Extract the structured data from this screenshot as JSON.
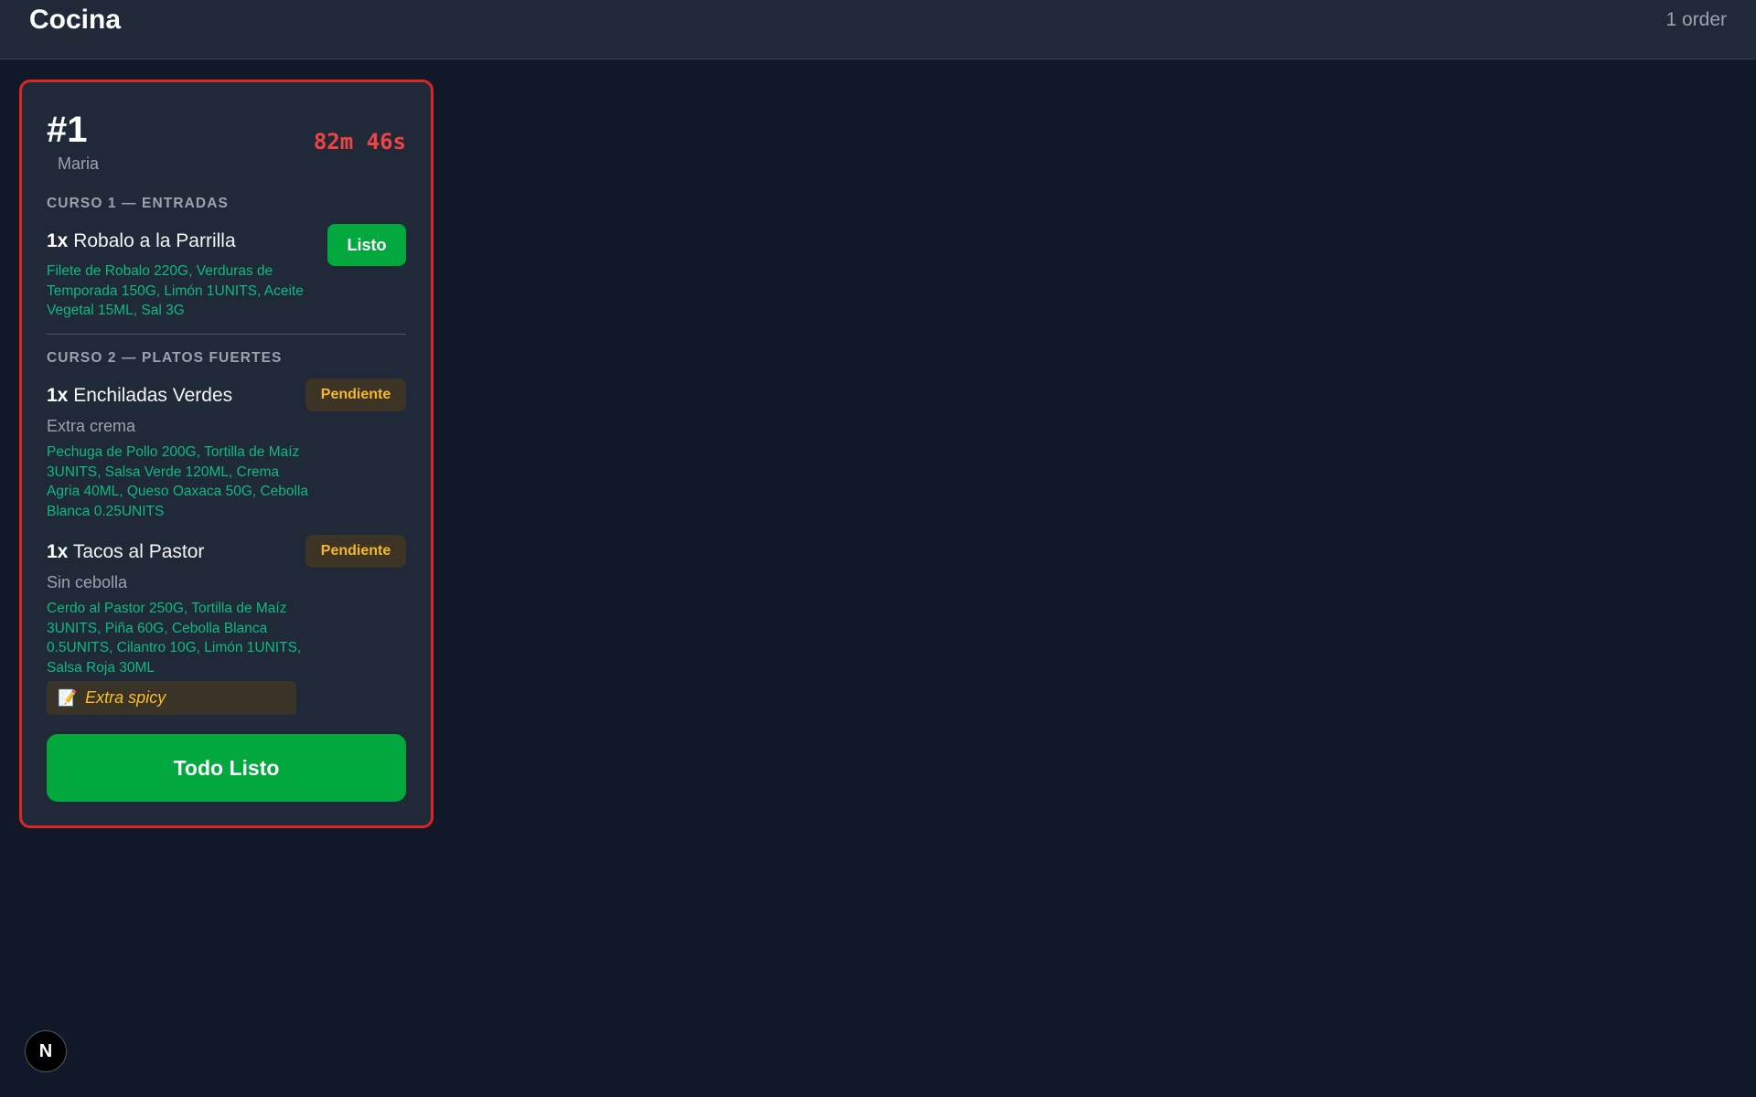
{
  "header": {
    "title": "Cocina",
    "order_count": "1 order"
  },
  "ticket": {
    "number": "#1",
    "customer": "Maria",
    "elapsed": "82m 46s",
    "courses": [
      {
        "header": "CURSO 1 — ENTRADAS",
        "items": [
          {
            "qty": "1x",
            "name": "Robalo a la Parrilla",
            "ingredients": "Filete de Robalo 220G, Verduras de Temporada 150G, Limón 1UNITS, Aceite Vegetal 15ML, Sal 3G",
            "status": "Listo"
          }
        ]
      },
      {
        "header": "CURSO 2 — PLATOS FUERTES",
        "items": [
          {
            "qty": "1x",
            "name": "Enchiladas Verdes",
            "modifier": "Extra crema",
            "ingredients": "Pechuga de Pollo 200G, Tortilla de Maíz 3UNITS, Salsa Verde 120ML, Crema Agria 40ML, Queso Oaxaca 50G, Cebolla Blanca 0.25UNITS",
            "status": "Pendiente"
          },
          {
            "qty": "1x",
            "name": "Tacos al Pastor",
            "modifier": "Sin cebolla",
            "ingredients": "Cerdo al Pastor 250G, Tortilla de Maíz 3UNITS, Piña 60G, Cebolla Blanca 0.5UNITS, Cilantro 10G, Limón 1UNITS, Salsa Roja 30ML",
            "status": "Pendiente",
            "note": "Extra spicy"
          }
        ]
      }
    ],
    "complete_label": "Todo Listo"
  },
  "dev_badge": "N",
  "icons": {
    "note": "memo-icon",
    "dev_badge": "nextjs-logo-icon"
  },
  "colors": {
    "background": "#111827",
    "panel": "#1f2937",
    "urgent_border": "#dc2626",
    "timer": "#ef4444",
    "ready": "#00a83d",
    "pending": "#f5b82b",
    "ingredients": "#10b981"
  }
}
